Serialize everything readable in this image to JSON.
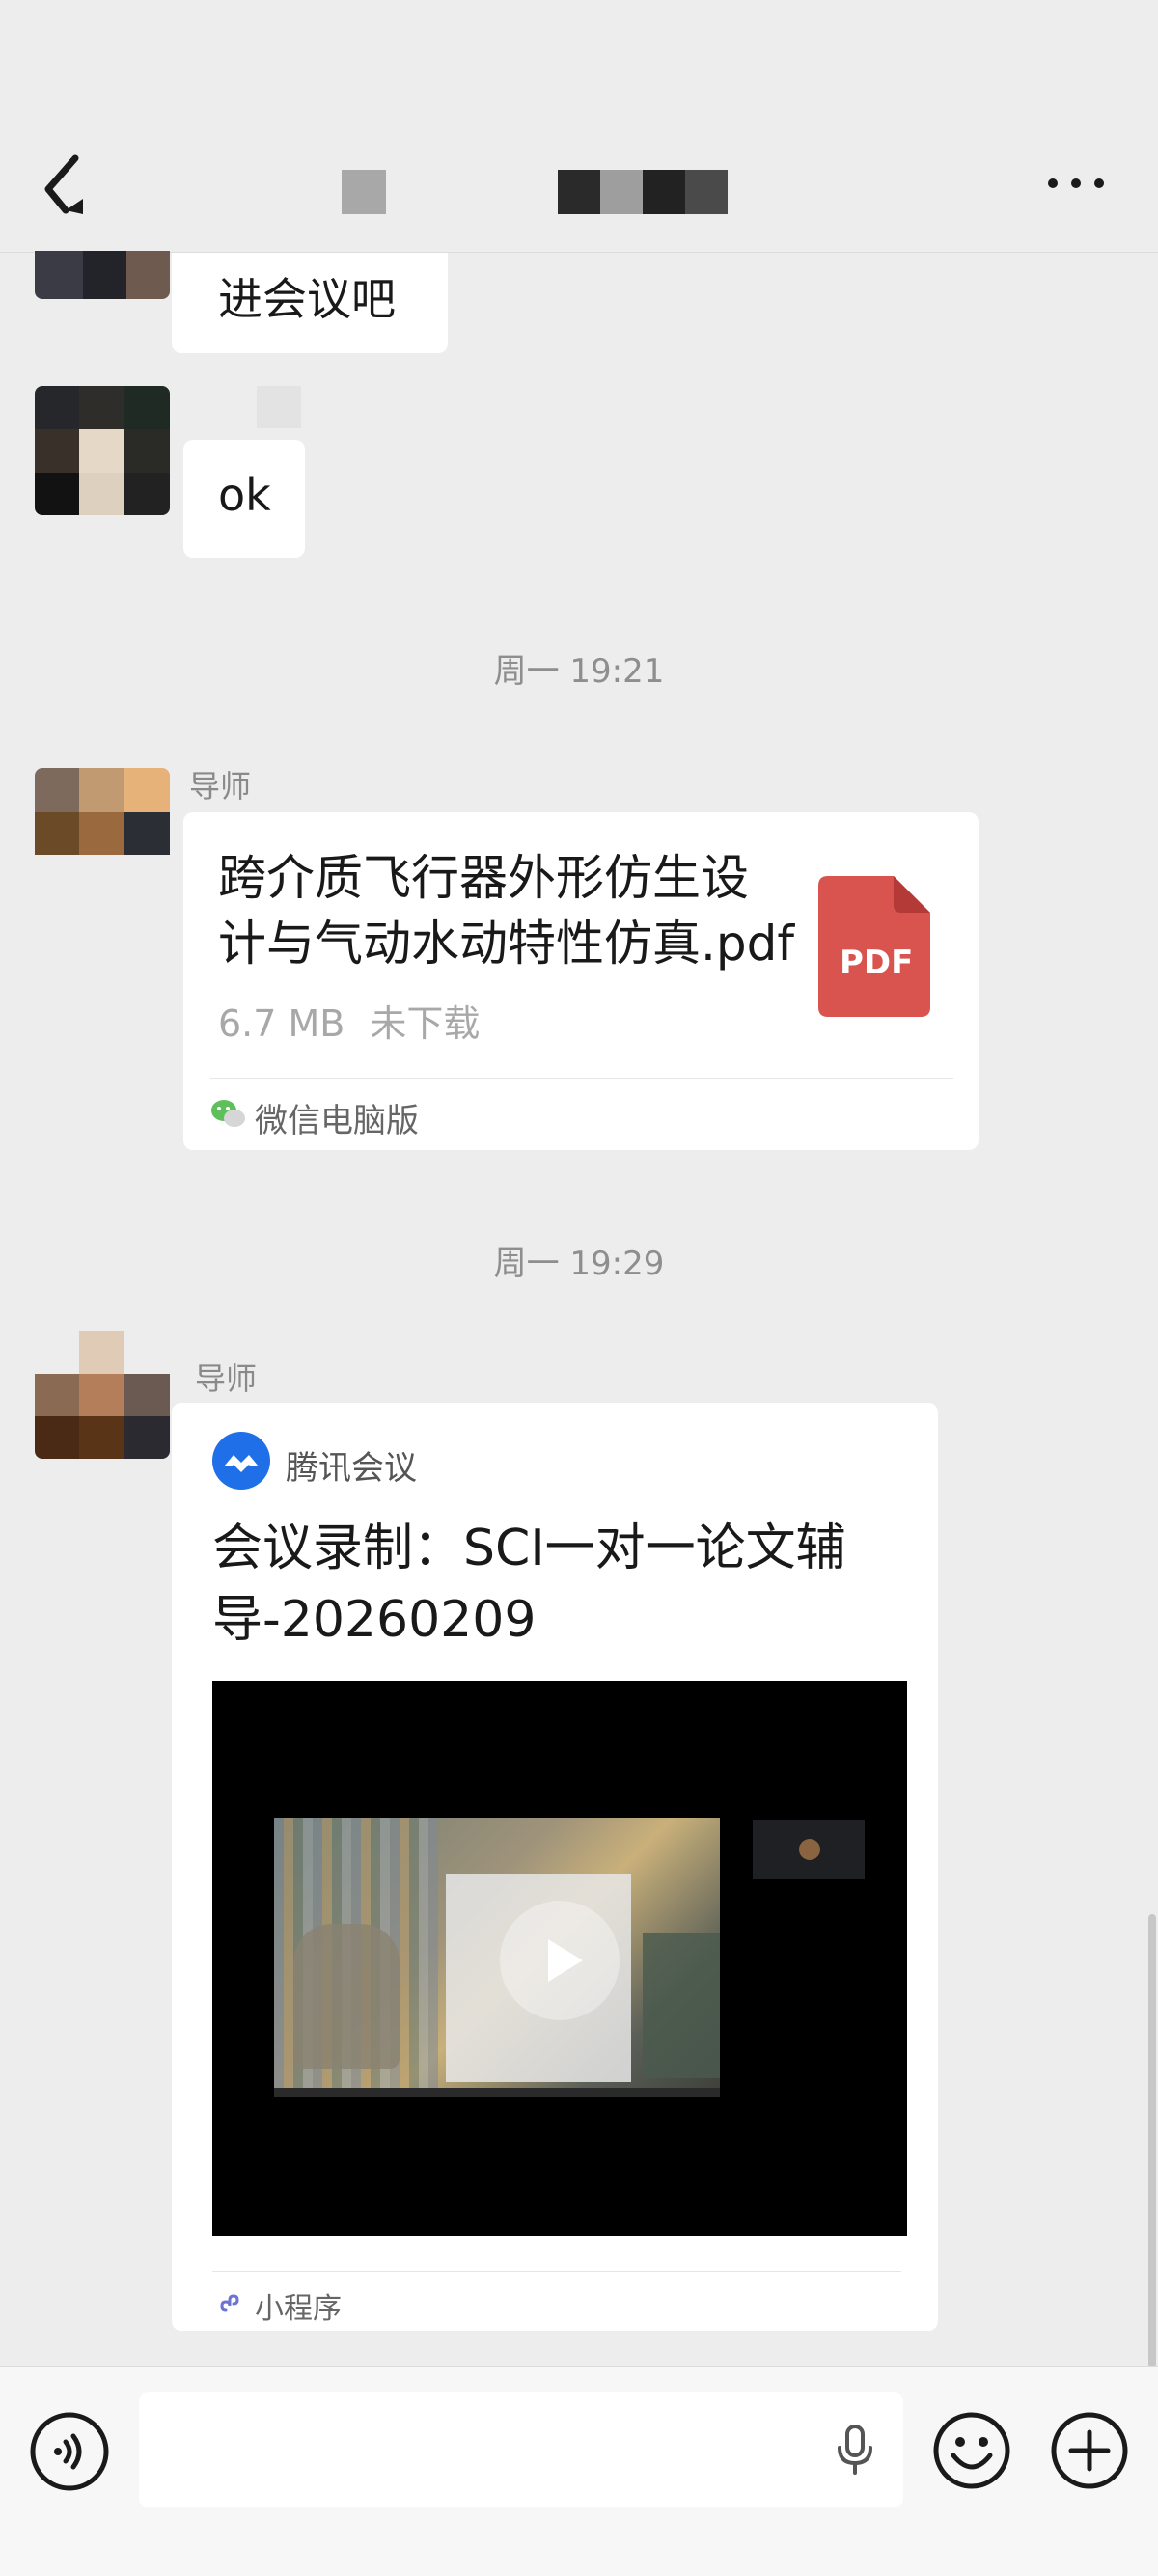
{
  "header": {
    "back_icon": "back-arrow-icon",
    "more_icon": "more-dots-icon"
  },
  "messages": [
    {
      "type": "text",
      "text": "进会议吧"
    },
    {
      "type": "text",
      "text": "ok"
    }
  ],
  "timestamps": [
    "周一 19:21",
    "周一 19:29"
  ],
  "file_message": {
    "sender": "导师",
    "file_name": "跨介质飞行器外形仿生设计与气动水动特性仿真.pdf",
    "file_name_line1": "跨介质飞行器外形仿生设",
    "file_name_line2": "计与气动水动特性仿真.pdf",
    "size": "6.7 MB",
    "status": "未下载",
    "pdf_badge": "PDF",
    "source": "微信电脑版",
    "pdf_color": "#d9534f"
  },
  "meeting_message": {
    "sender": "导师",
    "app_name": "腾讯会议",
    "title_line1": "会议录制：SCI一对一论文辅",
    "title_line2": "导-20260209",
    "source": "小程序"
  },
  "bottom_bar": {
    "voice_icon": "voice-icon",
    "mic_icon": "mic-icon",
    "emoji_icon": "emoji-icon",
    "plus_icon": "plus-icon"
  }
}
